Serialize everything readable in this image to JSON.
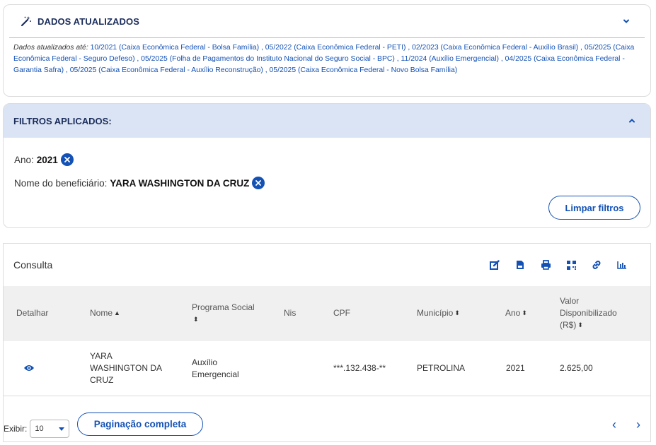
{
  "updated": {
    "title": "DADOS ATUALIZADOS",
    "lead": "Dados atualizados até:",
    "text": " 10/2021 (Caixa Econômica Federal - Bolsa Família) , 05/2022 (Caixa Econômica Federal - PETI) , 02/2023 (Caixa Econômica Federal - Auxílio Brasil) , 05/2025 (Caixa Econômica Federal - Seguro Defeso) , 05/2025 (Folha de Pagamentos do Instituto Nacional do Seguro Social - BPC) , 11/2024 (Auxílio Emergencial) , 04/2025 (Caixa Econômica Federal - Garantia Safra) , 05/2025 (Caixa Econômica Federal - Auxílio Reconstrução) , 05/2025 (Caixa Econômica Federal - Novo Bolsa Família)"
  },
  "filters": {
    "title": "FILTROS APLICADOS:",
    "ano_label": "Ano:",
    "ano_value": "2021",
    "nome_label": "Nome do beneficiário:",
    "nome_value": "YARA WASHINGTON DA CRUZ",
    "clear_label": "Limpar filtros"
  },
  "consulta": {
    "title": "Consulta",
    "tools": [
      "edit-icon",
      "file-icon",
      "print-icon",
      "qr-icon",
      "link-icon",
      "chart-icon"
    ],
    "columns": {
      "detalhar": "Detalhar",
      "nome": "Nome",
      "programa_l1": "Programa Social",
      "nis": "Nis",
      "cpf": "CPF",
      "municipio": "Município",
      "ano": "Ano",
      "valor_l1": "Valor",
      "valor_l2": "Disponibilizado",
      "valor_l3": "(R$)"
    },
    "rows": [
      {
        "nome_l1": "YARA",
        "nome_l2": "WASHINGTON DA",
        "nome_l3": "CRUZ",
        "programa_l1": "Auxílio",
        "programa_l2": "Emergencial",
        "nis": "",
        "cpf": "***.132.438-**",
        "municipio": "PETROLINA",
        "ano": "2021",
        "valor": "2.625,00"
      }
    ]
  },
  "pagination": {
    "exibir_label": "Exibir:",
    "page_size": "10",
    "full_label": "Paginação completa",
    "prev": "‹",
    "next": "›"
  },
  "colors": {
    "primary": "#1351b4",
    "header_bg": "#dbe4f4",
    "title_navy": "#1b2d5b"
  }
}
